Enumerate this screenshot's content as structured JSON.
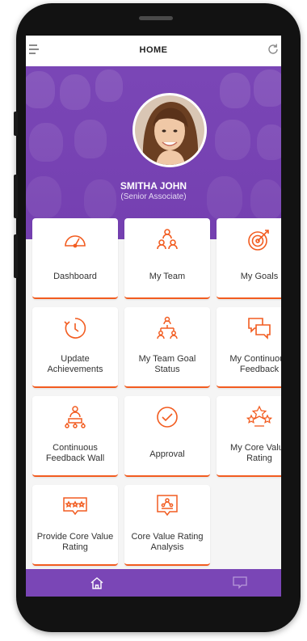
{
  "header": {
    "title": "HOME"
  },
  "profile": {
    "name": "SMITHA JOHN",
    "role": "(Senior Associate)"
  },
  "tiles": [
    {
      "label": "Dashboard",
      "icon": "speedometer-icon"
    },
    {
      "label": "My Team",
      "icon": "team-icon"
    },
    {
      "label": "My Goals",
      "icon": "target-icon"
    },
    {
      "label": "Update Achievements",
      "icon": "update-clock-icon"
    },
    {
      "label": "My Team Goal Status",
      "icon": "hierarchy-icon"
    },
    {
      "label": "My Continuous Feedback",
      "icon": "chat-bubbles-icon"
    },
    {
      "label": "Continuous Feedback Wall",
      "icon": "feedback-wall-icon"
    },
    {
      "label": "Approval",
      "icon": "check-circle-icon"
    },
    {
      "label": "My Core Value Rating",
      "icon": "stars-icon"
    },
    {
      "label": "Provide Core Value Rating",
      "icon": "rating-bubble-icon"
    },
    {
      "label": "Core Value Rating Analysis",
      "icon": "analysis-bubble-icon"
    }
  ],
  "colors": {
    "accent": "#f25c20",
    "brand": "#7a46b6"
  },
  "nav": {
    "home_icon": "home-icon",
    "chat_icon": "chat-icon"
  }
}
